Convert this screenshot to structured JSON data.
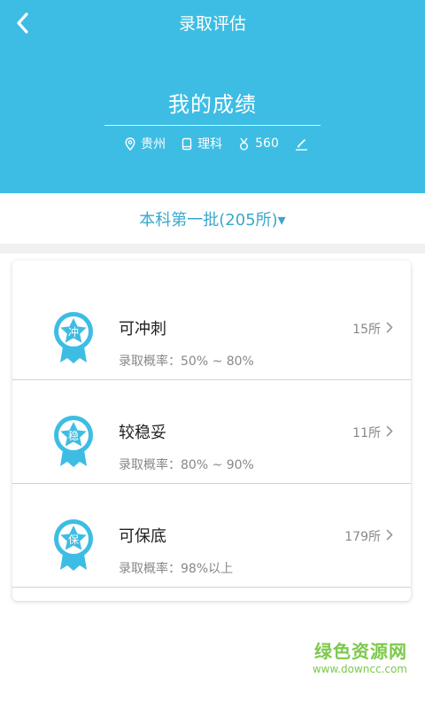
{
  "header": {
    "back_icon": "chevron-left-icon",
    "title": "录取评估",
    "score_title": "我的成绩",
    "province": "贵州",
    "subject": "理科",
    "score": "560",
    "icons": {
      "province": "location-pin-icon",
      "subject": "book-icon",
      "score": "medal-icon",
      "edit": "edit-pencil-icon"
    }
  },
  "batch": {
    "label": "本科第一批(205所)▾"
  },
  "categories": [
    {
      "title": "可冲刺",
      "badge": "冲",
      "probability": "录取概率：50% ~ 80%",
      "count": "15所"
    },
    {
      "title": "较稳妥",
      "badge": "稳",
      "probability": "录取概率：80% ~ 90%",
      "count": "11所"
    },
    {
      "title": "可保底",
      "badge": "保",
      "probability": "录取概率：98%以上",
      "count": "179所"
    }
  ],
  "watermark": {
    "main": "绿色资源网",
    "url": "www.downcc.com"
  },
  "colors": {
    "primary": "#3dbde3",
    "batch_text": "#3aa7cc",
    "badge": "#3dbde3",
    "watermark": "#7bc94a"
  }
}
